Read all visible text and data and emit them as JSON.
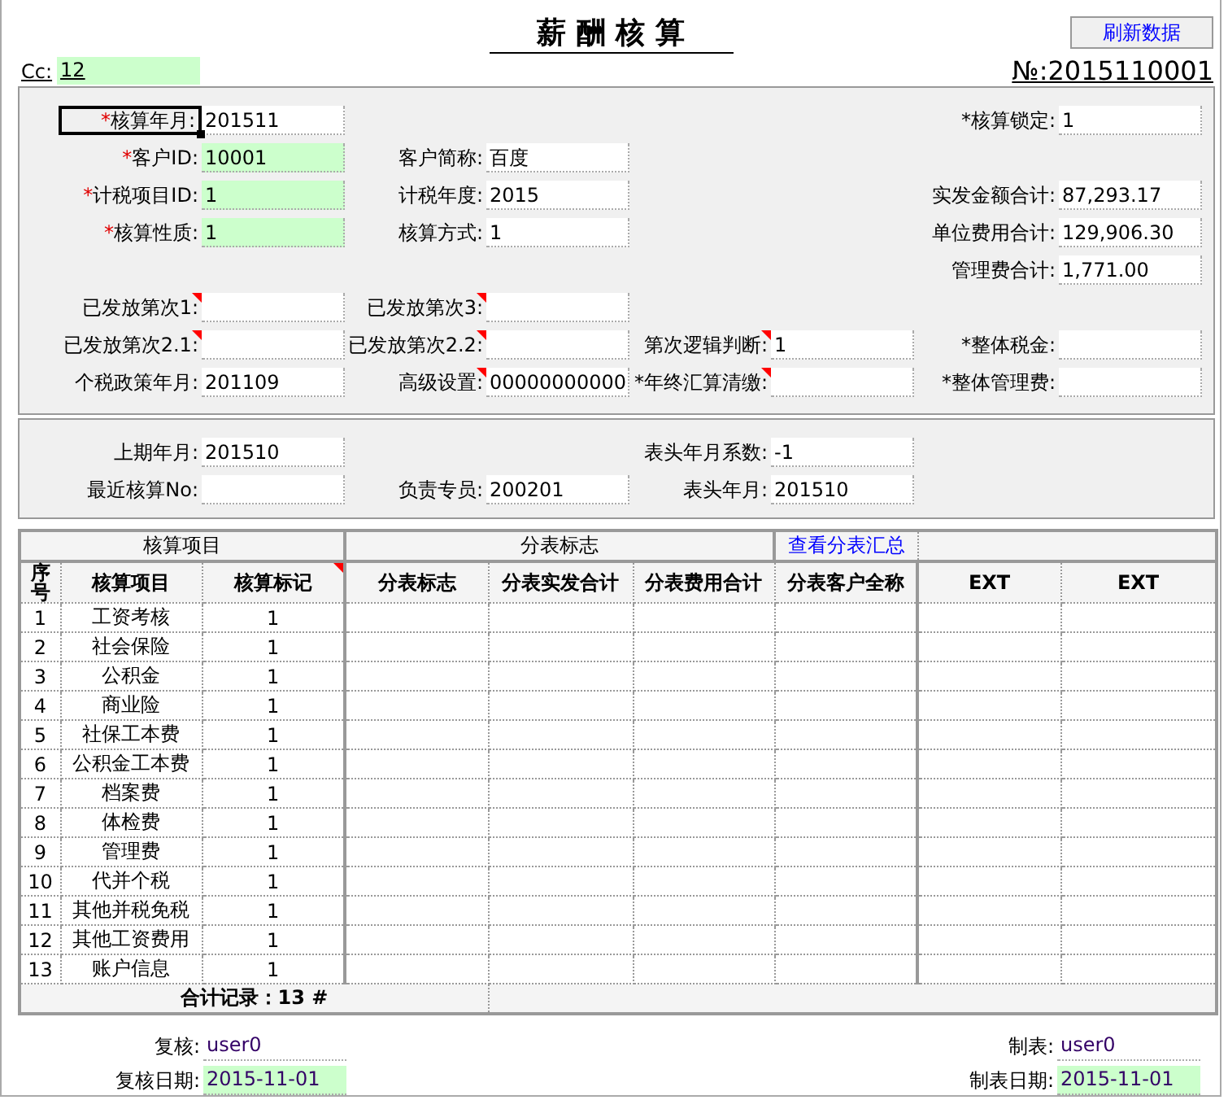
{
  "header": {
    "title": "薪 酬 核 算",
    "refresh_button": "刷新数据",
    "cc_label": "Cc:",
    "cc_value": "12",
    "number": "№:2015110001"
  },
  "form_sections": [
    {
      "rows": [
        [
          {
            "required_mark": "*",
            "label": "核算年月:",
            "value": "201511",
            "highlight": false,
            "flagged": false,
            "focused": true
          },
          null,
          null,
          {
            "label": "*核算锁定:",
            "value": "1",
            "highlight": false,
            "flagged": false,
            "focused": false
          }
        ],
        [
          {
            "required_mark": "*",
            "label": "客户ID:",
            "value": "10001",
            "highlight": true,
            "flagged": false,
            "focused": false
          },
          {
            "label": "客户简称:",
            "value": "百度",
            "highlight": false,
            "flagged": false,
            "focused": false
          },
          null,
          null
        ],
        [
          {
            "required_mark": "*",
            "label": "计税项目ID:",
            "value": "1",
            "highlight": true,
            "flagged": false,
            "focused": false
          },
          {
            "label": "计税年度:",
            "value": "2015",
            "highlight": false,
            "flagged": false,
            "focused": false
          },
          null,
          {
            "label": "实发金额合计:",
            "value": "87,293.17",
            "highlight": false,
            "flagged": false,
            "focused": false
          }
        ],
        [
          {
            "required_mark": "*",
            "label": "核算性质:",
            "value": "1",
            "highlight": true,
            "flagged": false,
            "focused": false
          },
          {
            "label": "核算方式:",
            "value": "1",
            "highlight": false,
            "flagged": false,
            "focused": false
          },
          null,
          {
            "label": "单位费用合计:",
            "value": "129,906.30",
            "highlight": false,
            "flagged": false,
            "focused": false
          }
        ],
        [
          null,
          null,
          null,
          {
            "label": "管理费合计:",
            "value": "1,771.00",
            "highlight": false,
            "flagged": false,
            "focused": false
          }
        ],
        [
          {
            "label": "已发放第次1:",
            "highlight": false,
            "flagged": true,
            "focused": false
          },
          {
            "label": "已发放第次3:",
            "highlight": false,
            "flagged": true,
            "focused": false
          },
          null,
          null
        ],
        [
          {
            "label": "已发放第次2.1:",
            "highlight": false,
            "flagged": true,
            "focused": false
          },
          {
            "label": "已发放第次2.2:",
            "highlight": false,
            "flagged": true,
            "focused": false
          },
          {
            "label": "第次逻辑判断:",
            "value": "1",
            "highlight": false,
            "flagged": true,
            "focused": false
          },
          {
            "label": "*整体税金:",
            "highlight": false,
            "flagged": false,
            "focused": false
          }
        ],
        [
          {
            "label": "个税政策年月:",
            "value": "201109",
            "highlight": false,
            "flagged": false,
            "focused": false
          },
          {
            "label": "高级设置:",
            "value": "00000000000",
            "highlight": false,
            "flagged": true,
            "focused": false
          },
          {
            "label": "*年终汇算清缴:",
            "highlight": false,
            "flagged": true,
            "focused": false
          },
          {
            "label": "*整体管理费:",
            "highlight": false,
            "flagged": false,
            "focused": false
          }
        ]
      ]
    },
    {
      "rows": [
        [
          {
            "label": "上期年月:",
            "value": "201510",
            "highlight": false,
            "flagged": false,
            "focused": false
          },
          null,
          {
            "label": "表头年月系数:",
            "value": "-1",
            "highlight": false,
            "flagged": false,
            "focused": false
          },
          null
        ],
        [
          {
            "label": "最近核算No:",
            "highlight": false,
            "flagged": false,
            "focused": false
          },
          {
            "label": "负责专员:",
            "value": "200201",
            "highlight": false,
            "flagged": false,
            "focused": false
          },
          {
            "label": "表头年月:",
            "value": "201510",
            "highlight": false,
            "flagged": false,
            "focused": false
          },
          null
        ]
      ]
    }
  ],
  "table": {
    "group_headers": [
      {
        "label": "核算项目",
        "kind": "text"
      },
      {
        "label": "分表标志",
        "kind": "text"
      },
      {
        "label": "查看分表汇总",
        "kind": "link"
      }
    ],
    "columns": [
      {
        "label": "序号",
        "flagged": false
      },
      {
        "label": "核算项目",
        "flagged": false
      },
      {
        "label": "核算标记",
        "flagged": true
      },
      {
        "label": "分表标志",
        "flagged": false
      },
      {
        "label": "分表实发合计",
        "flagged": false
      },
      {
        "label": "分表费用合计",
        "flagged": false
      },
      {
        "label": "分表客户全称",
        "flagged": false
      },
      {
        "label": "EXT",
        "flagged": false
      },
      {
        "label": "EXT",
        "flagged": false
      }
    ],
    "rows": [
      {
        "no": "1",
        "item": "工资考核",
        "mark": "1"
      },
      {
        "no": "2",
        "item": "社会保险",
        "mark": "1"
      },
      {
        "no": "3",
        "item": "公积金",
        "mark": "1"
      },
      {
        "no": "4",
        "item": "商业险",
        "mark": "1"
      },
      {
        "no": "5",
        "item": "社保工本费",
        "mark": "1"
      },
      {
        "no": "6",
        "item": "公积金工本费",
        "mark": "1"
      },
      {
        "no": "7",
        "item": "档案费",
        "mark": "1"
      },
      {
        "no": "8",
        "item": "体检费",
        "mark": "1"
      },
      {
        "no": "9",
        "item": "管理费",
        "mark": "1"
      },
      {
        "no": "10",
        "item": "代并个税",
        "mark": "1"
      },
      {
        "no": "11",
        "item": "其他并税免税",
        "mark": "1"
      },
      {
        "no": "12",
        "item": "其他工资费用",
        "mark": "1"
      },
      {
        "no": "13",
        "item": "账户信息",
        "mark": "1"
      }
    ],
    "total": "合计记录：13 #"
  },
  "footer": {
    "left": [
      {
        "label": "复核:",
        "value": "user0",
        "highlight": false
      },
      {
        "label": "复核日期:",
        "value": "2015-11-01",
        "highlight": true
      }
    ],
    "right": [
      {
        "label": "制表:",
        "value": "user0",
        "highlight": false
      },
      {
        "label": "制表日期:",
        "value": "2015-11-01",
        "highlight": true
      }
    ]
  }
}
